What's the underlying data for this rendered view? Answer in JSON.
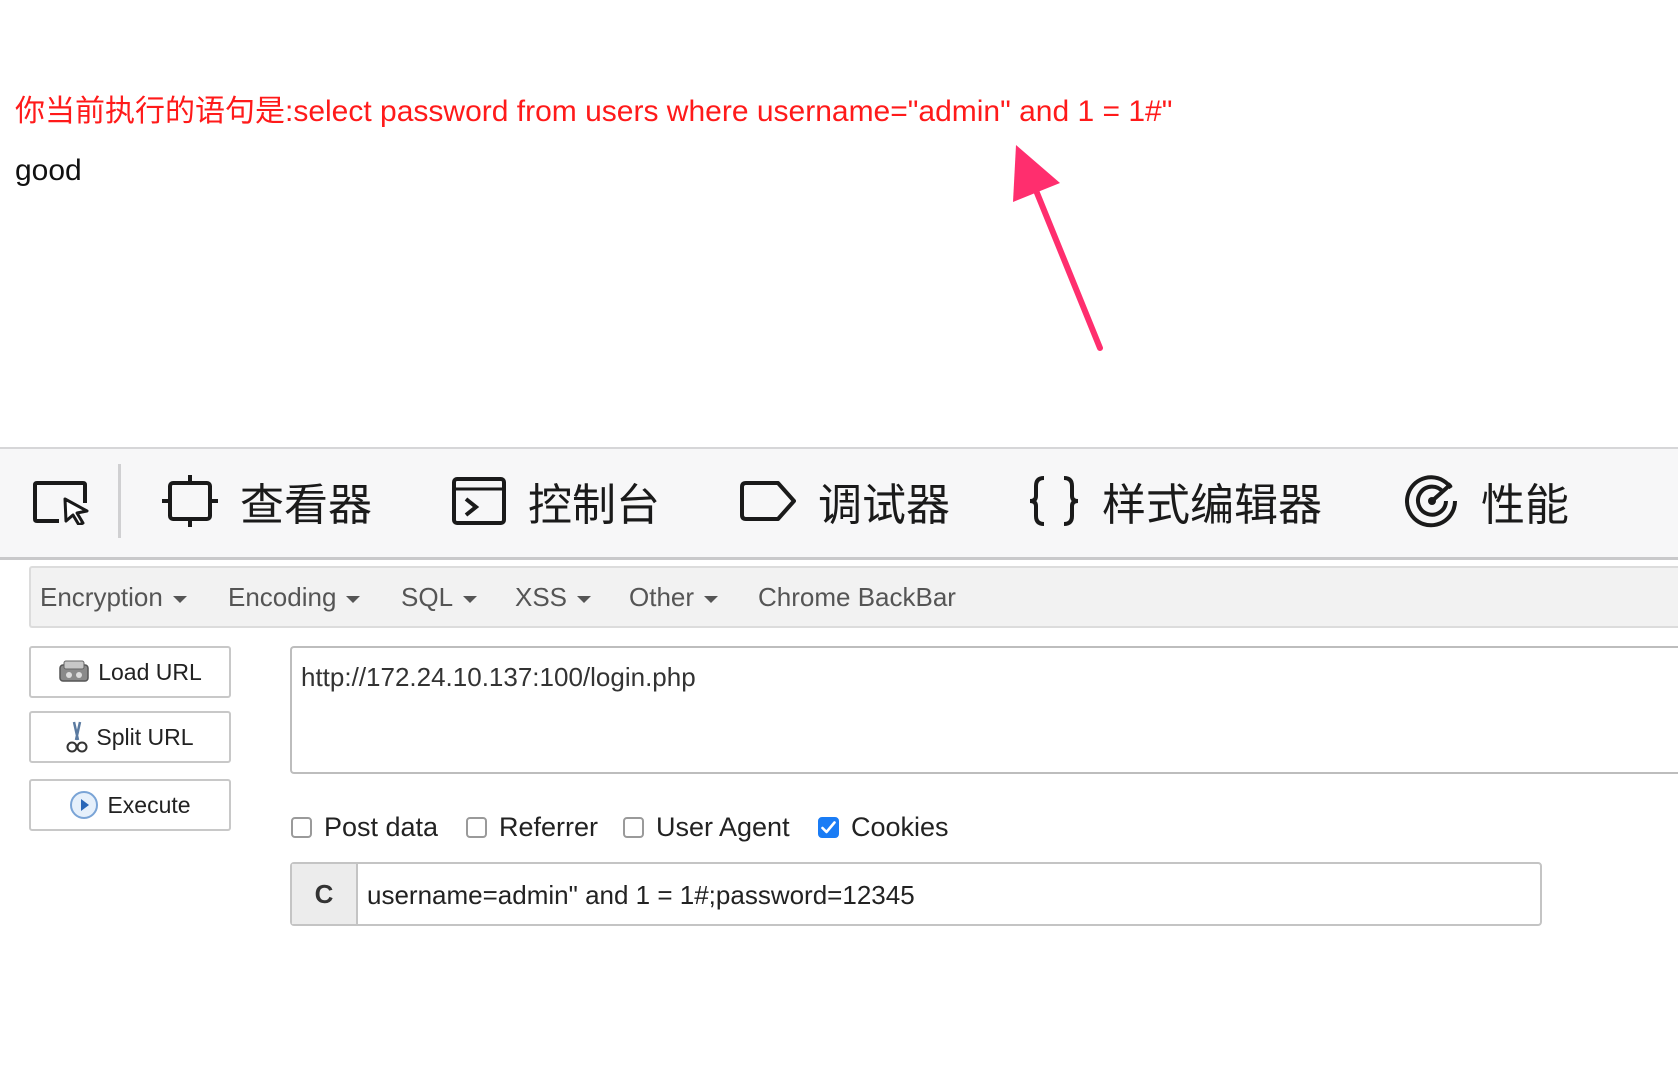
{
  "page": {
    "sql_statement": "你当前执行的语句是:select password from users where username=\"admin\" and 1 = 1#\"",
    "result": "good"
  },
  "devtools": {
    "tabs": [
      {
        "label": "查看器",
        "icon": "inspector-icon"
      },
      {
        "label": "控制台",
        "icon": "console-icon"
      },
      {
        "label": "调试器",
        "icon": "debugger-icon"
      },
      {
        "label": "样式编辑器",
        "icon": "style-editor-icon"
      },
      {
        "label": "性能",
        "icon": "performance-icon"
      }
    ]
  },
  "hackbar": {
    "menu": [
      "Encryption",
      "Encoding",
      "SQL",
      "XSS",
      "Other",
      "Chrome BackBar"
    ],
    "buttons": {
      "load_url": "Load URL",
      "split_url": "Split URL",
      "execute": "Execute"
    },
    "url": "http://172.24.10.137:100/login.php",
    "options": {
      "post_data": {
        "label": "Post data",
        "checked": false
      },
      "referrer": {
        "label": "Referrer",
        "checked": false
      },
      "user_agent": {
        "label": "User Agent",
        "checked": false
      },
      "cookies": {
        "label": "Cookies",
        "checked": true
      }
    },
    "cookie_field": {
      "label": "C",
      "value": "username=admin\" and 1 = 1#;password=12345"
    }
  },
  "colors": {
    "sql_text": "#ff1a1a",
    "annotation_arrow": "#ff2e6e",
    "checkbox_checked": "#1a7cf5"
  }
}
